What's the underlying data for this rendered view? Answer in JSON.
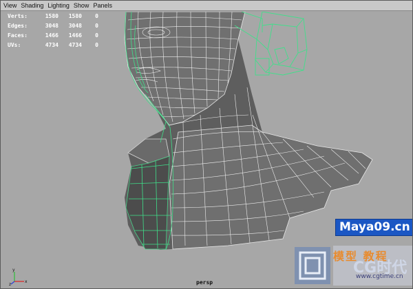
{
  "menu": [
    {
      "label": "View"
    },
    {
      "label": "Shading"
    },
    {
      "label": "Lighting"
    },
    {
      "label": "Show"
    },
    {
      "label": "Panels"
    }
  ],
  "hud": [
    {
      "label": "Verts:",
      "total": "1580",
      "object": "1580",
      "selected": "0"
    },
    {
      "label": "Edges:",
      "total": "3048",
      "object": "3048",
      "selected": "0"
    },
    {
      "label": "Faces:",
      "total": "1466",
      "object": "1466",
      "selected": "0"
    },
    {
      "label": "UVs:",
      "total": "4734",
      "object": "4734",
      "selected": "0"
    }
  ],
  "camera": "persp",
  "axis": {
    "x": "x",
    "y": "y",
    "z": "z"
  },
  "watermark": {
    "site": "Maya09.cn",
    "subtitle": "模型 教程",
    "brand": "CG时代",
    "url": "www.cgtime.cn"
  },
  "colors": {
    "selection_wire": "#3fe08a",
    "mesh_wire": "#ffffff",
    "mesh_fill": "#7a7a7a",
    "viewport_bg": "#a7a7a7"
  }
}
